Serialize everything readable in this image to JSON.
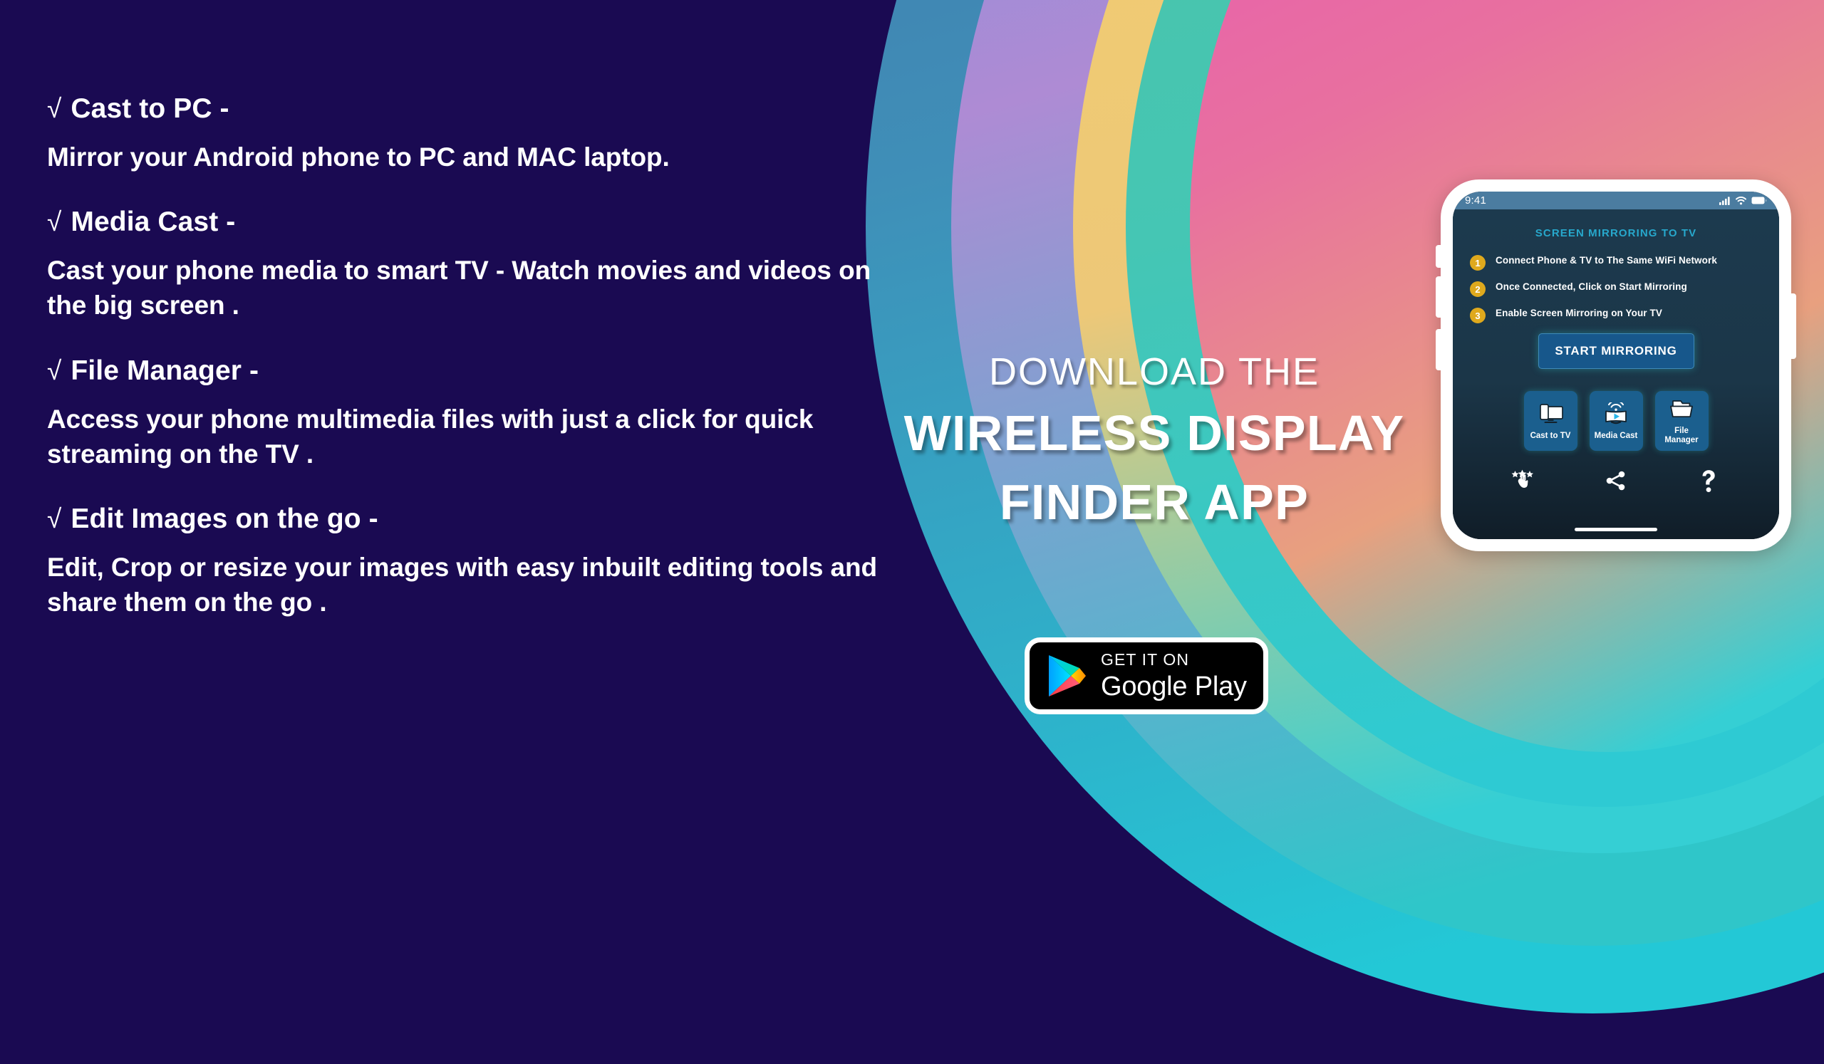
{
  "background": {
    "base_color": "#1a0a52",
    "arc_colors": [
      "#3f6fa3",
      "#8f8fe0",
      "#f1cb6e",
      "#4fc2a8",
      "#e8609f"
    ]
  },
  "features": [
    {
      "tick": "√",
      "title": "Cast to PC -",
      "desc": "Mirror your Android phone to PC and MAC laptop."
    },
    {
      "tick": "√",
      "title": "Media Cast -",
      "desc": "Cast your phone media to smart TV - Watch movies and videos on the big screen ."
    },
    {
      "tick": "√",
      "title": "File Manager -",
      "desc": "Access your phone multimedia files with just a click for quick streaming on the TV ."
    },
    {
      "tick": "√",
      "title": "Edit Images on the go -",
      "desc": "Edit, Crop or resize your images with easy inbuilt editing tools and share them on the go ."
    }
  ],
  "headline": {
    "line1": "DOWNLOAD THE",
    "line2": "WIRELESS DISPLAY",
    "line3": "FINDER APP"
  },
  "google_play": {
    "top_label": "GET IT ON",
    "bottom_label": "Google Play",
    "icon": "google-play-triangle"
  },
  "phone": {
    "status_bar": {
      "time": "9:41",
      "icons": [
        "cellular-signal-icon",
        "wifi-icon",
        "battery-icon"
      ],
      "bg_color": "#4b7ca0"
    },
    "app": {
      "title": "SCREEN MIRRORING TO TV",
      "title_color": "#27a8cc",
      "steps": [
        {
          "number": "1",
          "text": "Connect Phone & TV to The Same WiFi Network"
        },
        {
          "number": "2",
          "text": "Once Connected, Click on Start Mirroring"
        },
        {
          "number": "3",
          "text": "Enable Screen Mirroring on Your TV"
        }
      ],
      "start_button": "START MIRRORING",
      "tiles": [
        {
          "label": "Cast to TV",
          "icon": "monitor-phone-icon"
        },
        {
          "label": "Media Cast",
          "icon": "tv-cast-play-icon"
        },
        {
          "label": "File Manager",
          "icon": "folder-icon"
        }
      ],
      "actions": [
        {
          "name": "rate-stars-icon"
        },
        {
          "name": "share-icon"
        },
        {
          "name": "help-question-icon"
        }
      ],
      "badge_color": "#dfa91d",
      "tile_color": "#1b5f8e"
    }
  }
}
